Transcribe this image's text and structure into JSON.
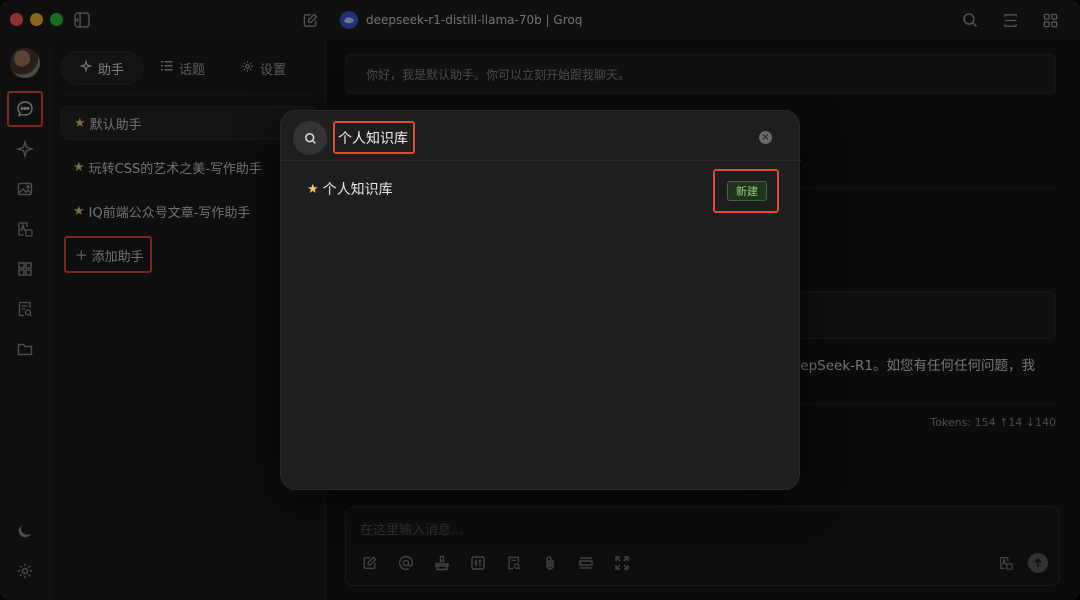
{
  "window": {
    "title": "deepseek-r1-distill-llama-70b | Groq"
  },
  "titlebar": {
    "icons": [
      "sidebar-toggle-icon",
      "new-chat-icon",
      "search-icon",
      "minimize-window-icon",
      "layout-grid-icon"
    ]
  },
  "rail": {
    "items": [
      "chat-icon",
      "sparkle-icon",
      "image-icon",
      "translate-icon",
      "apps-icon",
      "knowledge-search-icon",
      "folder-icon"
    ],
    "bottom": [
      "moon-icon",
      "gear-icon"
    ]
  },
  "panel": {
    "tabs": [
      {
        "label": "助手",
        "icon": "sparkle-icon"
      },
      {
        "label": "话题",
        "icon": "list-icon"
      },
      {
        "label": "设置",
        "icon": "gear-icon"
      }
    ],
    "assistants": [
      {
        "label": "默认助手",
        "active": true
      },
      {
        "label": "玩转CSS的艺术之美-写作助手",
        "active": false
      },
      {
        "label": "IQ前端公众号文章-写作助手",
        "active": false
      }
    ],
    "add_label": "添加助手"
  },
  "main": {
    "welcome": "你好，我是默认助手。你可以立刻开始跟我聊天。",
    "reply_line1": "eepSeek-R1。如您有任何任何问题，我",
    "tokens": "Tokens: 154 ↑14 ↓140",
    "composer_placeholder": "在这里输入消息..."
  },
  "modal": {
    "search_value": "个人知识库",
    "result_label": "个人知识库",
    "new_label": "新建"
  },
  "colors": {
    "highlight": "#e34a32",
    "star": "#e9c46a",
    "new_text": "#8fd17a"
  }
}
